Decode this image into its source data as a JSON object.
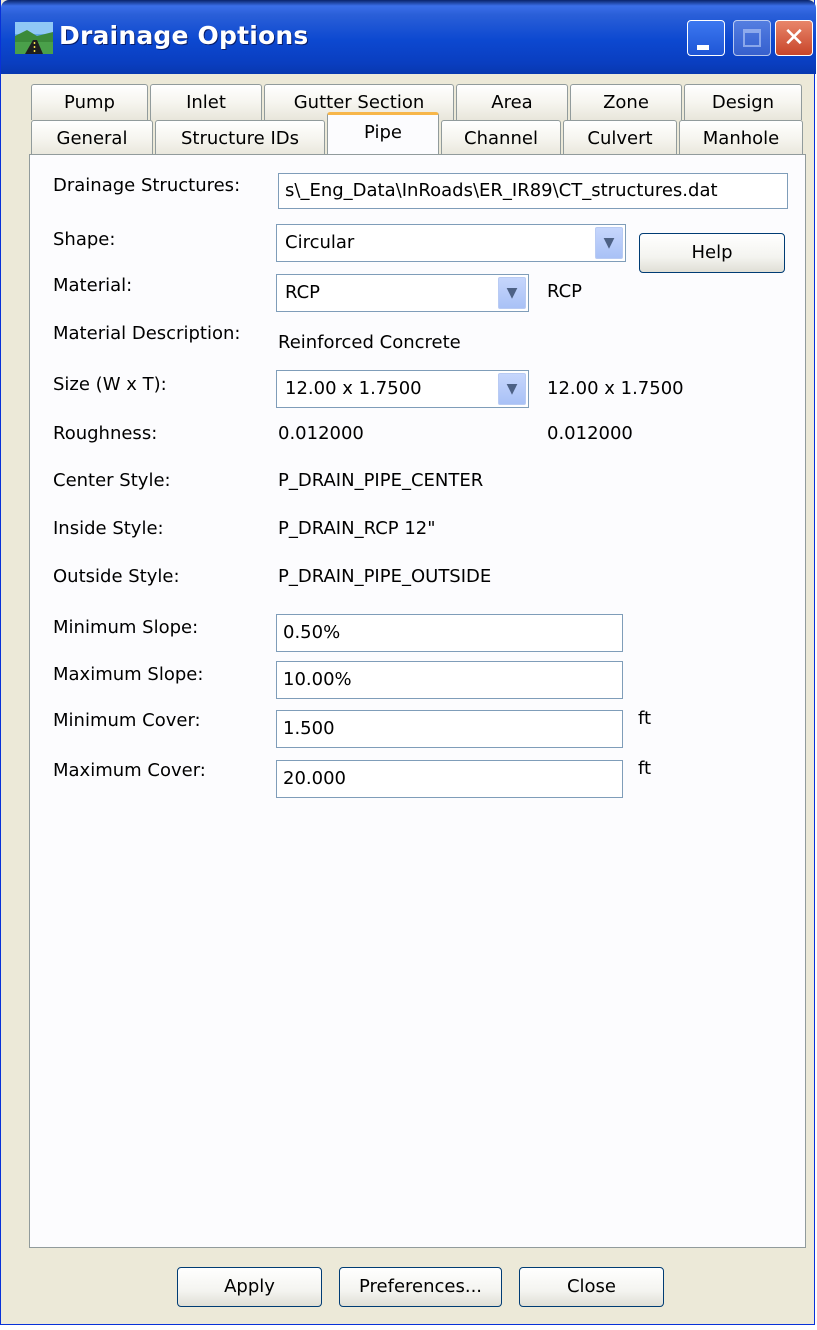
{
  "window": {
    "title": "Drainage Options"
  },
  "tabs": {
    "row1": [
      "Pump",
      "Inlet",
      "Gutter Section",
      "Area",
      "Zone",
      "Design"
    ],
    "row2": [
      "General",
      "Structure IDs",
      "Pipe",
      "Channel",
      "Culvert",
      "Manhole"
    ],
    "active": "Pipe"
  },
  "form": {
    "drainage_structures": {
      "label": "Drainage Structures:",
      "value": "s\\_Eng_Data\\InRoads\\ER_IR89\\CT_structures.dat"
    },
    "shape": {
      "label": "Shape:",
      "value": "Circular"
    },
    "material": {
      "label": "Material:",
      "value": "RCP",
      "side_value": "RCP"
    },
    "material_description": {
      "label": "Material Description:",
      "value": "Reinforced Concrete"
    },
    "size": {
      "label": "Size (W x T):",
      "value": "12.00 x 1.7500",
      "side_value": "12.00 x 1.7500"
    },
    "roughness": {
      "label": "Roughness:",
      "value": "0.012000",
      "side_value": "0.012000"
    },
    "center_style": {
      "label": "Center Style:",
      "value": "P_DRAIN_PIPE_CENTER"
    },
    "inside_style": {
      "label": "Inside Style:",
      "value": "P_DRAIN_RCP 12\""
    },
    "outside_style": {
      "label": "Outside Style:",
      "value": "P_DRAIN_PIPE_OUTSIDE"
    },
    "minimum_slope": {
      "label": "Minimum Slope:",
      "value": "0.50%"
    },
    "maximum_slope": {
      "label": "Maximum Slope:",
      "value": "10.00%"
    },
    "minimum_cover": {
      "label": "Minimum Cover:",
      "value": "1.500",
      "unit": "ft"
    },
    "maximum_cover": {
      "label": "Maximum Cover:",
      "value": "20.000",
      "unit": "ft"
    }
  },
  "buttons": {
    "help": "Help",
    "apply": "Apply",
    "preferences": "Preferences...",
    "close": "Close"
  },
  "icons": {
    "window_icon": "landscape-icon",
    "minimize": "minimize-icon",
    "maximize": "maximize-icon",
    "close": "close-icon",
    "dropdown": "chevron-down-icon"
  },
  "colors": {
    "titlebar": "#0c48d0",
    "dialog_bg": "#ece9d8",
    "panel_bg": "#fcfcfe",
    "active_tab_accent": "#f7b64a",
    "field_border": "#7f9db9",
    "close_button": "#c8452a"
  }
}
